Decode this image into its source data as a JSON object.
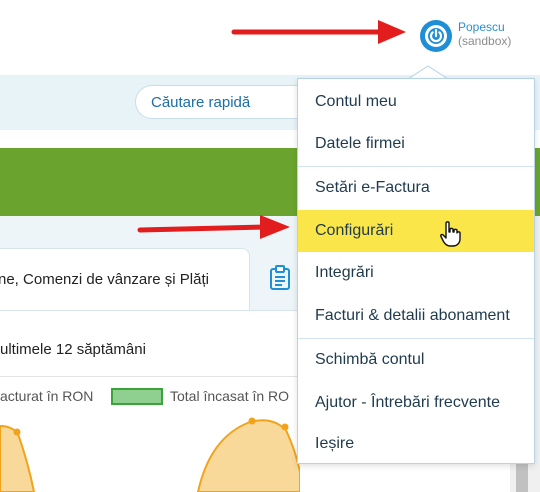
{
  "user": {
    "name": "Popescu",
    "env": "(sandbox)"
  },
  "search": {
    "label": "Căutare rapidă"
  },
  "tabs": {
    "active_label": "ne, Comenzi de vânzare și Plăți"
  },
  "panel": {
    "title": "ultimele 12 săptămâni"
  },
  "legend": {
    "series1": "acturat în RON",
    "series2": "Total încasat în RO"
  },
  "menu": {
    "items": [
      {
        "label": "Contul meu"
      },
      {
        "label": "Datele firmei"
      },
      {
        "label": "Setări e-Factura"
      },
      {
        "label": "Configurări"
      },
      {
        "label": "Integrări"
      },
      {
        "label": "Facturi & detalii abonament"
      },
      {
        "label": "Schimbă contul"
      },
      {
        "label": "Ajutor - Întrebări frecvente"
      },
      {
        "label": "Ieșire"
      }
    ],
    "highlighted_index": 3
  },
  "colors": {
    "accent": "#2a8fd0",
    "banner": "#6aa42f",
    "highlight": "#fbe64a",
    "arrow": "#e21d1d",
    "chart_line": "#f2a31c"
  }
}
